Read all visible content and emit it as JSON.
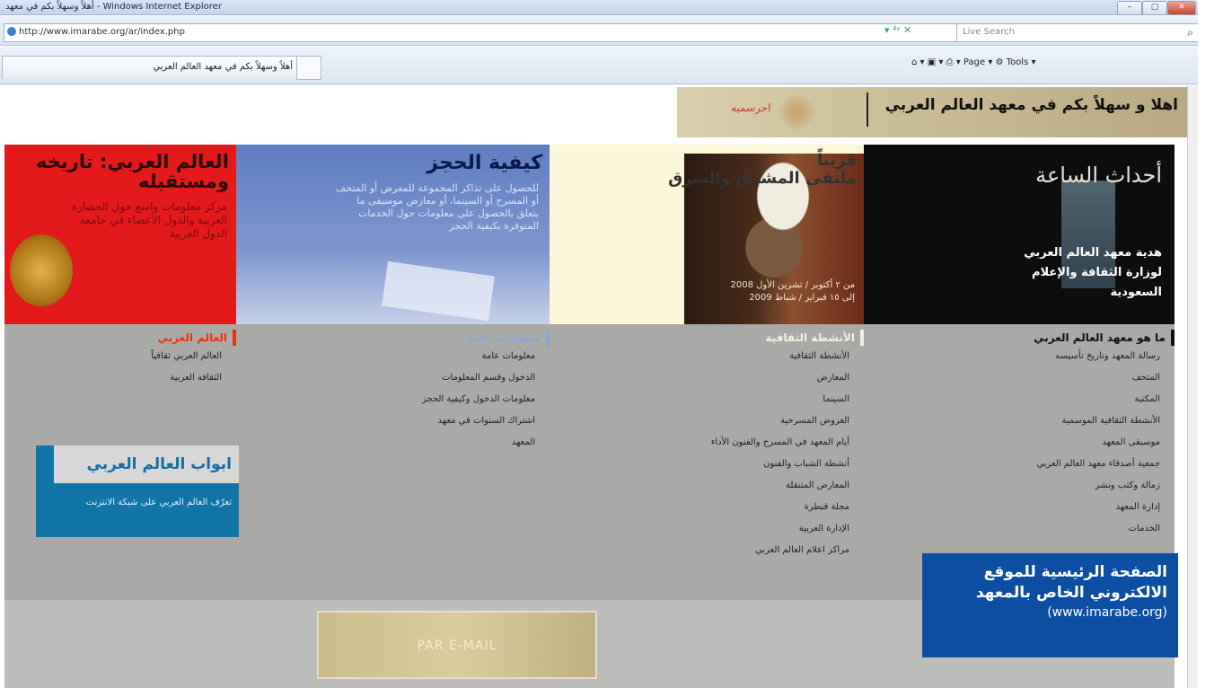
{
  "window": {
    "title": "أهلاً وسهلاً بكم في معهد - Windows Internet Explorer",
    "controls": [
      "–",
      "▢",
      "✕"
    ]
  },
  "address_bar": {
    "url": "http://www.imarabe.org/ar/index.php",
    "controls_text": "▾  ⁴ʸ  ✕",
    "search_placeholder": "Live Search",
    "search_icon": "search-icon"
  },
  "tab": {
    "label": "أهلاً وسهلاً بكم في معهد العالم العربي"
  },
  "command_bar": {
    "items_text": "⌂ ▾  ▣ ▾  ⎙ ▾  Page ▾  ⚙ Tools ▾"
  },
  "banner": {
    "greeting": "اهلا و سهلاً بكم في معهد العالم العربي",
    "english_link": "احرسميه"
  },
  "panels": [
    {
      "title": "العالم العربي: تاريخه ومستقبله",
      "description": "مركز معلومات واسع حول الحضارة العربية والدول الأعضاء في جامعة الدول العربية"
    },
    {
      "title": "كيفية الحجز",
      "description": "للحصول على تذاكر المجموعة للمعرض أو المتحف أو المسرح أو السينما، أو معارض موسيقى ما يتعلق بالحصول على معلومات حول الخدمات المتوفرة بكيفية الحجز"
    },
    {
      "title_line1": "قريباً",
      "title_line2": "ملتقى المشرق والشرق",
      "caption_line1": "من ٢ أكتوبر / تشرين الأول 2008",
      "caption_line2": "إلى ١٥ فبراير / شباط 2009"
    },
    {
      "title": "أحداث الساعة",
      "description_line1": "هدية معهد العالم العربي",
      "description_line2": "لوزارة الثقافة والإعلام",
      "description_line3": "السعودية"
    }
  ],
  "columns": [
    {
      "heading": "العالم العربي",
      "items": [
        "العالم العربي ثقافياً",
        "الثقافة العربية"
      ]
    },
    {
      "heading": "معلومات عامة",
      "items": [
        "معلومات عامة",
        "الدخول وقسم المعلومات",
        "معلومات الدخول وكيفية الحجز",
        "اشتراك السنوات في معهد",
        "المعهد"
      ]
    },
    {
      "heading": "الأنشطة الثقافية",
      "items": [
        "الأنشطة الثقافية",
        "المعارض",
        "السينما",
        "العروض المسرحية",
        "أيام المعهد في المسرح والفنون الأداء",
        "أنشطة الشباب والفنون",
        "المعارض المتنقلة",
        "مجلة قنطرة",
        "الإدارة العربية",
        "مراكز اعلام العالم العربي"
      ]
    },
    {
      "heading": "ما هو معهد العالم العربي",
      "items": [
        "رسالة المعهد وتاريخ تأسيسه",
        "المتحف",
        "المكتبة",
        "الأنشطة الثقافية الموسمية",
        "موسيقى المعهد",
        "جمعية أصدقاء معهد العالم العربي",
        "زمالة وكتب ونشر",
        "إدارة المعهد",
        "الخدمات"
      ]
    }
  ],
  "abwab": {
    "title": "ابواب العالم العربي",
    "description": "تعرّف العالم العربي على شبكة الانترنت"
  },
  "email_button": {
    "label": "PAR E-MAIL"
  },
  "caption": {
    "line1": "الصفحة الرئيسية للموقع",
    "line2": "الالكتروني الخاص بالمعهد",
    "line3": "(www.imarabe.org)"
  }
}
